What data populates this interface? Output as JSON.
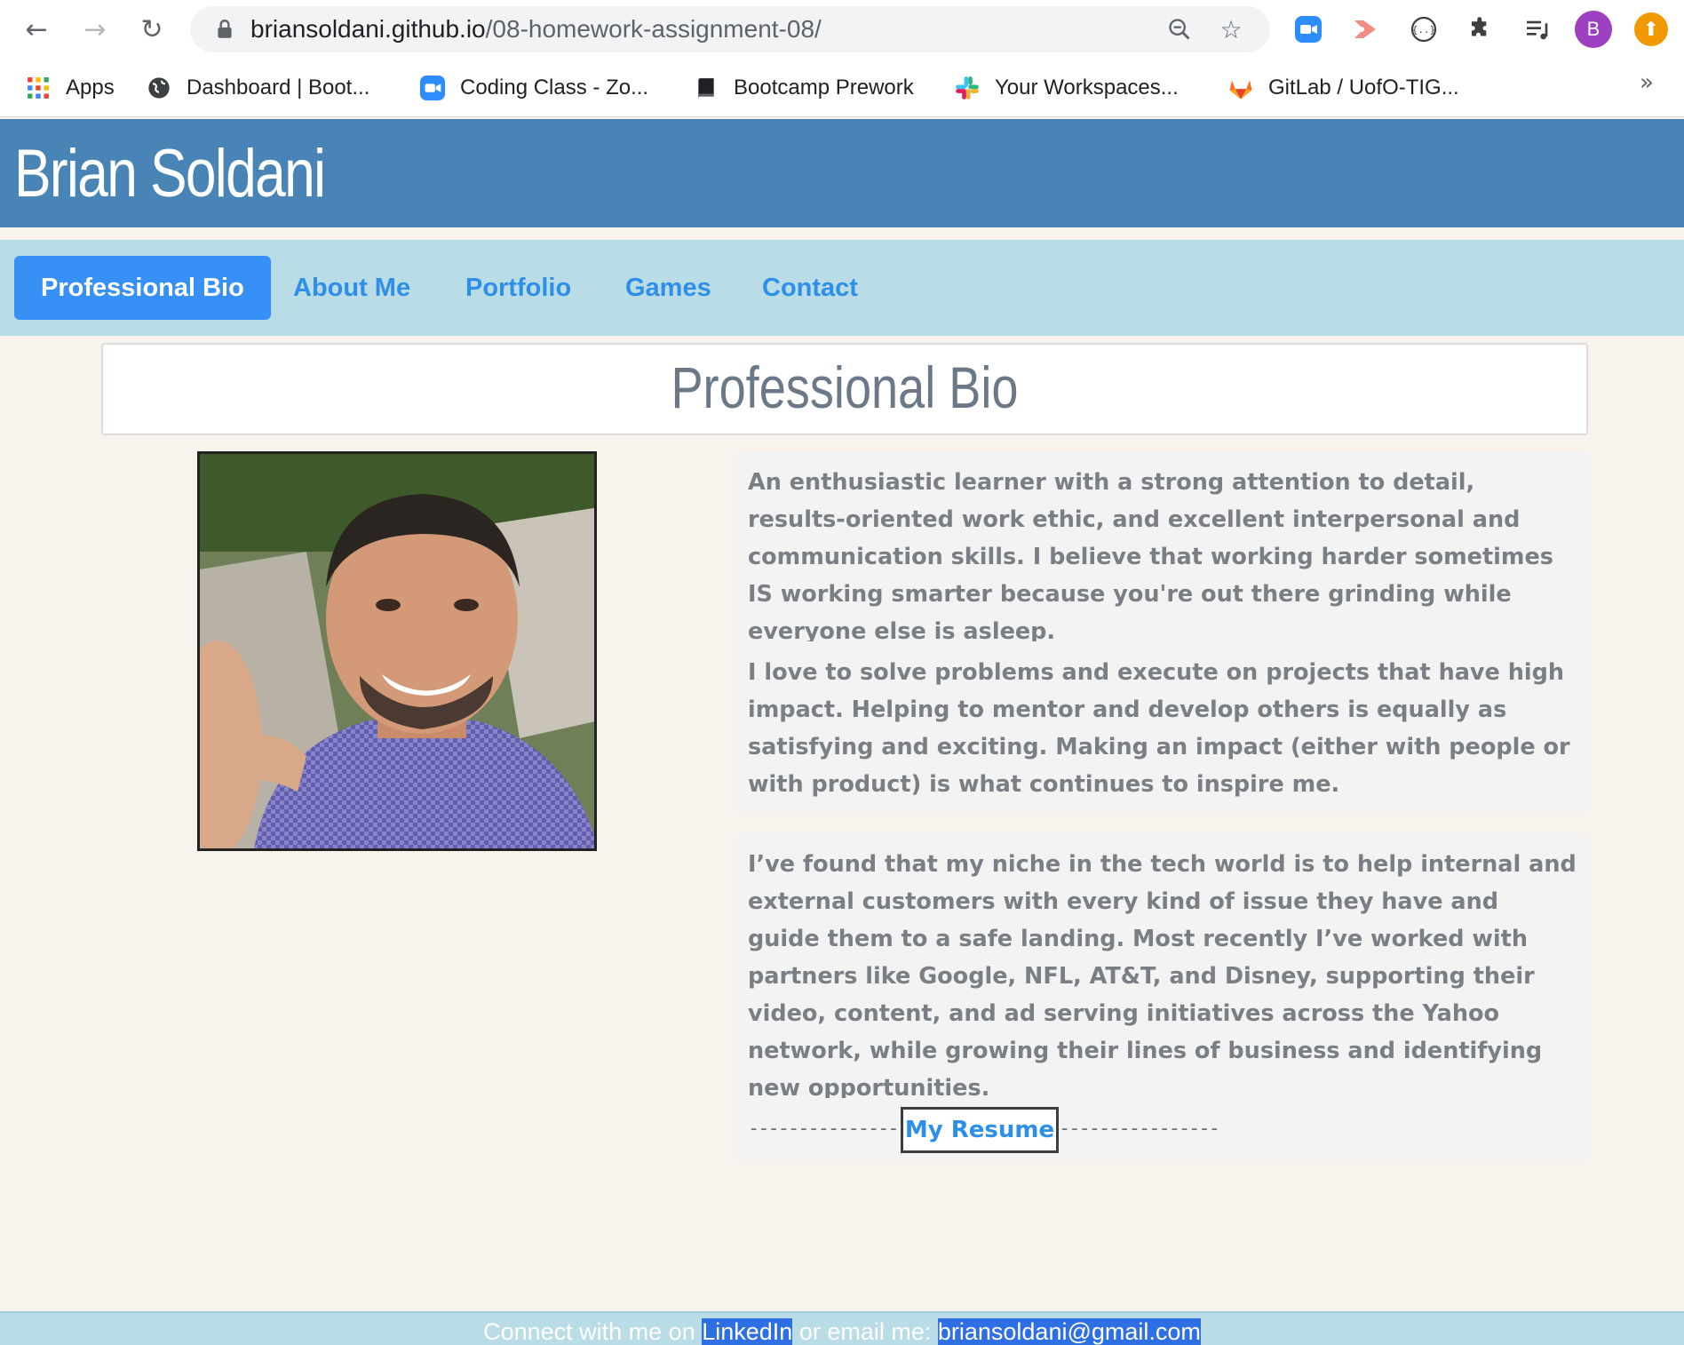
{
  "browser": {
    "url_host": "briansoldani.github.io",
    "url_path": "/08-homework-assignment-08/",
    "profile_initial": "B",
    "bookmarks": [
      {
        "label": "Apps",
        "icon": "apps-grid-icon"
      },
      {
        "label": "Dashboard | Boot...",
        "icon": "globe-icon"
      },
      {
        "label": "Coding Class - Zo...",
        "icon": "zoom-icon"
      },
      {
        "label": "Bootcamp Prework",
        "icon": "book-icon"
      },
      {
        "label": "Your Workspaces...",
        "icon": "slack-icon"
      },
      {
        "label": "GitLab / UofO-TIG...",
        "icon": "gitlab-icon"
      }
    ],
    "more_bookmarks": "»"
  },
  "site": {
    "title": "Brian Soldani",
    "nav": [
      {
        "label": "Professional Bio",
        "active": true
      },
      {
        "label": "About Me",
        "active": false
      },
      {
        "label": "Portfolio",
        "active": false
      },
      {
        "label": "Games",
        "active": false
      },
      {
        "label": "Contact",
        "active": false
      }
    ]
  },
  "bio": {
    "heading": "Professional Bio",
    "paragraphs": [
      "An enthusiastic learner with a strong attention to detail, results-oriented work ethic, and excellent interpersonal and communication skills. I believe that working harder sometimes IS working smarter because you're out there grinding while everyone else is asleep.",
      "I love to solve problems and execute on projects that have high impact. Helping to mentor and develop others is equally as satisfying and exciting. Making an impact (either with people or with product) is what continues to inspire me.",
      "I’ve found that my niche in the tech world is to help internal and external customers with every kind of issue they have and guide them to a safe landing. Most recently I’ve worked with partners like Google, NFL, AT&T, and Disney, supporting their video, content, and ad serving initiatives across the Yahoo network, while growing their lines of business and identifying new opportunities."
    ],
    "resume_dashes_left": "----------------",
    "resume_label": "My Resume",
    "resume_dashes_right": "----------------"
  },
  "footer": {
    "prefix": "Connect with me on ",
    "linkedin": "LinkedIn",
    "middle": " or email me: ",
    "email": "briansoldani@gmail.com"
  },
  "colors": {
    "header_bg": "#4884b5",
    "nav_bg": "#b9dce6",
    "accent": "#3790f5",
    "page_bg": "#f9f3ee"
  }
}
